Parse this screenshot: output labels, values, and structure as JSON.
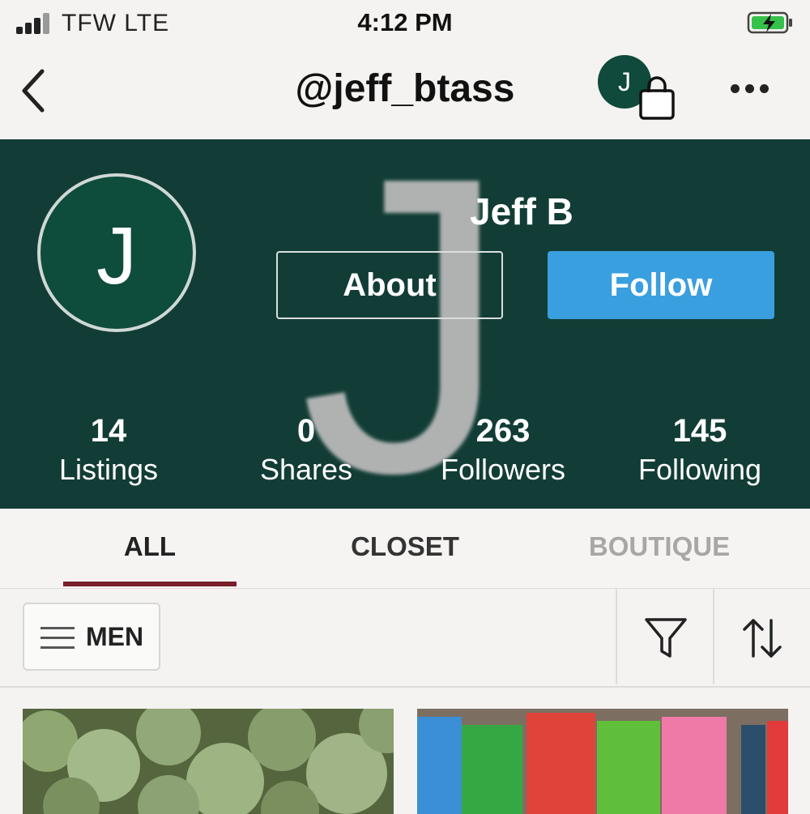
{
  "status_bar": {
    "carrier": "TFW  LTE",
    "time": "4:12 PM"
  },
  "nav": {
    "handle": "@jeff_btass",
    "avatar_initial": "J"
  },
  "profile": {
    "avatar_initial": "J",
    "name": "Jeff B",
    "about_label": "About",
    "follow_label": "Follow",
    "stats": [
      {
        "value": "14",
        "label": "Listings"
      },
      {
        "value": "0",
        "label": "Shares"
      },
      {
        "value": "263",
        "label": "Followers"
      },
      {
        "value": "145",
        "label": "Following"
      }
    ]
  },
  "tabs": [
    {
      "label": "ALL",
      "active": true
    },
    {
      "label": "CLOSET",
      "active": false
    },
    {
      "label": "BOUTIQUE",
      "active": false
    }
  ],
  "filter": {
    "department_label": "MEN"
  },
  "colors": {
    "hero_bg": "#123d36",
    "follow_blue": "#3a9fde",
    "tab_accent": "#7a1f2b",
    "avatar_green": "#0e4c3c"
  },
  "icons": [
    "signal-icon",
    "battery-charging-icon",
    "back-chevron-icon",
    "shopping-bag-icon",
    "more-dots-icon",
    "hamburger-icon",
    "filter-funnel-icon",
    "sort-arrows-icon"
  ]
}
